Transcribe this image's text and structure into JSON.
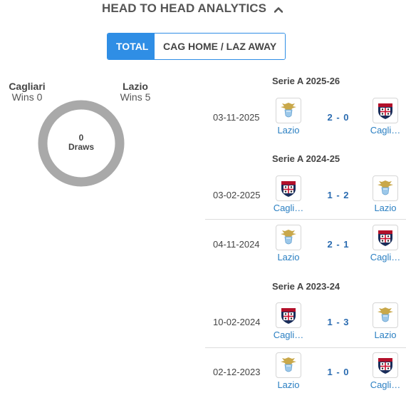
{
  "header": {
    "title": "HEAD TO HEAD ANALYTICS"
  },
  "tabs": [
    {
      "label": "TOTAL",
      "active": true
    },
    {
      "label": "CAG HOME / LAZ AWAY",
      "active": false
    }
  ],
  "summary": {
    "home": {
      "name": "Cagliari",
      "wins": "Wins 0"
    },
    "away": {
      "name": "Lazio",
      "wins": "Wins 5"
    },
    "draws_count": "0",
    "draws_label": "Draws"
  },
  "competitions": [
    {
      "title": "Serie A 2025-26",
      "matches": [
        {
          "date": "03-11-2025",
          "home": "Lazio",
          "home_crest": "lazio-crest",
          "away": "Cagli…",
          "away_crest": "cagliari-crest",
          "score_home": "2",
          "score_away": "0"
        }
      ]
    },
    {
      "title": "Serie A 2024-25",
      "matches": [
        {
          "date": "03-02-2025",
          "home": "Cagli…",
          "home_crest": "cagliari-crest",
          "away": "Lazio",
          "away_crest": "lazio-crest",
          "score_home": "1",
          "score_away": "2"
        },
        {
          "date": "04-11-2024",
          "home": "Lazio",
          "home_crest": "lazio-crest",
          "away": "Cagli…",
          "away_crest": "cagliari-crest",
          "score_home": "2",
          "score_away": "1"
        }
      ]
    },
    {
      "title": "Serie A 2023-24",
      "matches": [
        {
          "date": "10-02-2024",
          "home": "Cagli…",
          "home_crest": "cagliari-crest",
          "away": "Lazio",
          "away_crest": "lazio-crest",
          "score_home": "1",
          "score_away": "3"
        },
        {
          "date": "02-12-2023",
          "home": "Lazio",
          "home_crest": "lazio-crest",
          "away": "Cagli…",
          "away_crest": "cagliari-crest",
          "score_home": "1",
          "score_away": "0"
        }
      ]
    }
  ],
  "colors": {
    "accent": "#2f8ee5",
    "link": "#2a7fc2",
    "score": "#2a6bb0",
    "donut": "#a9a9a9"
  }
}
